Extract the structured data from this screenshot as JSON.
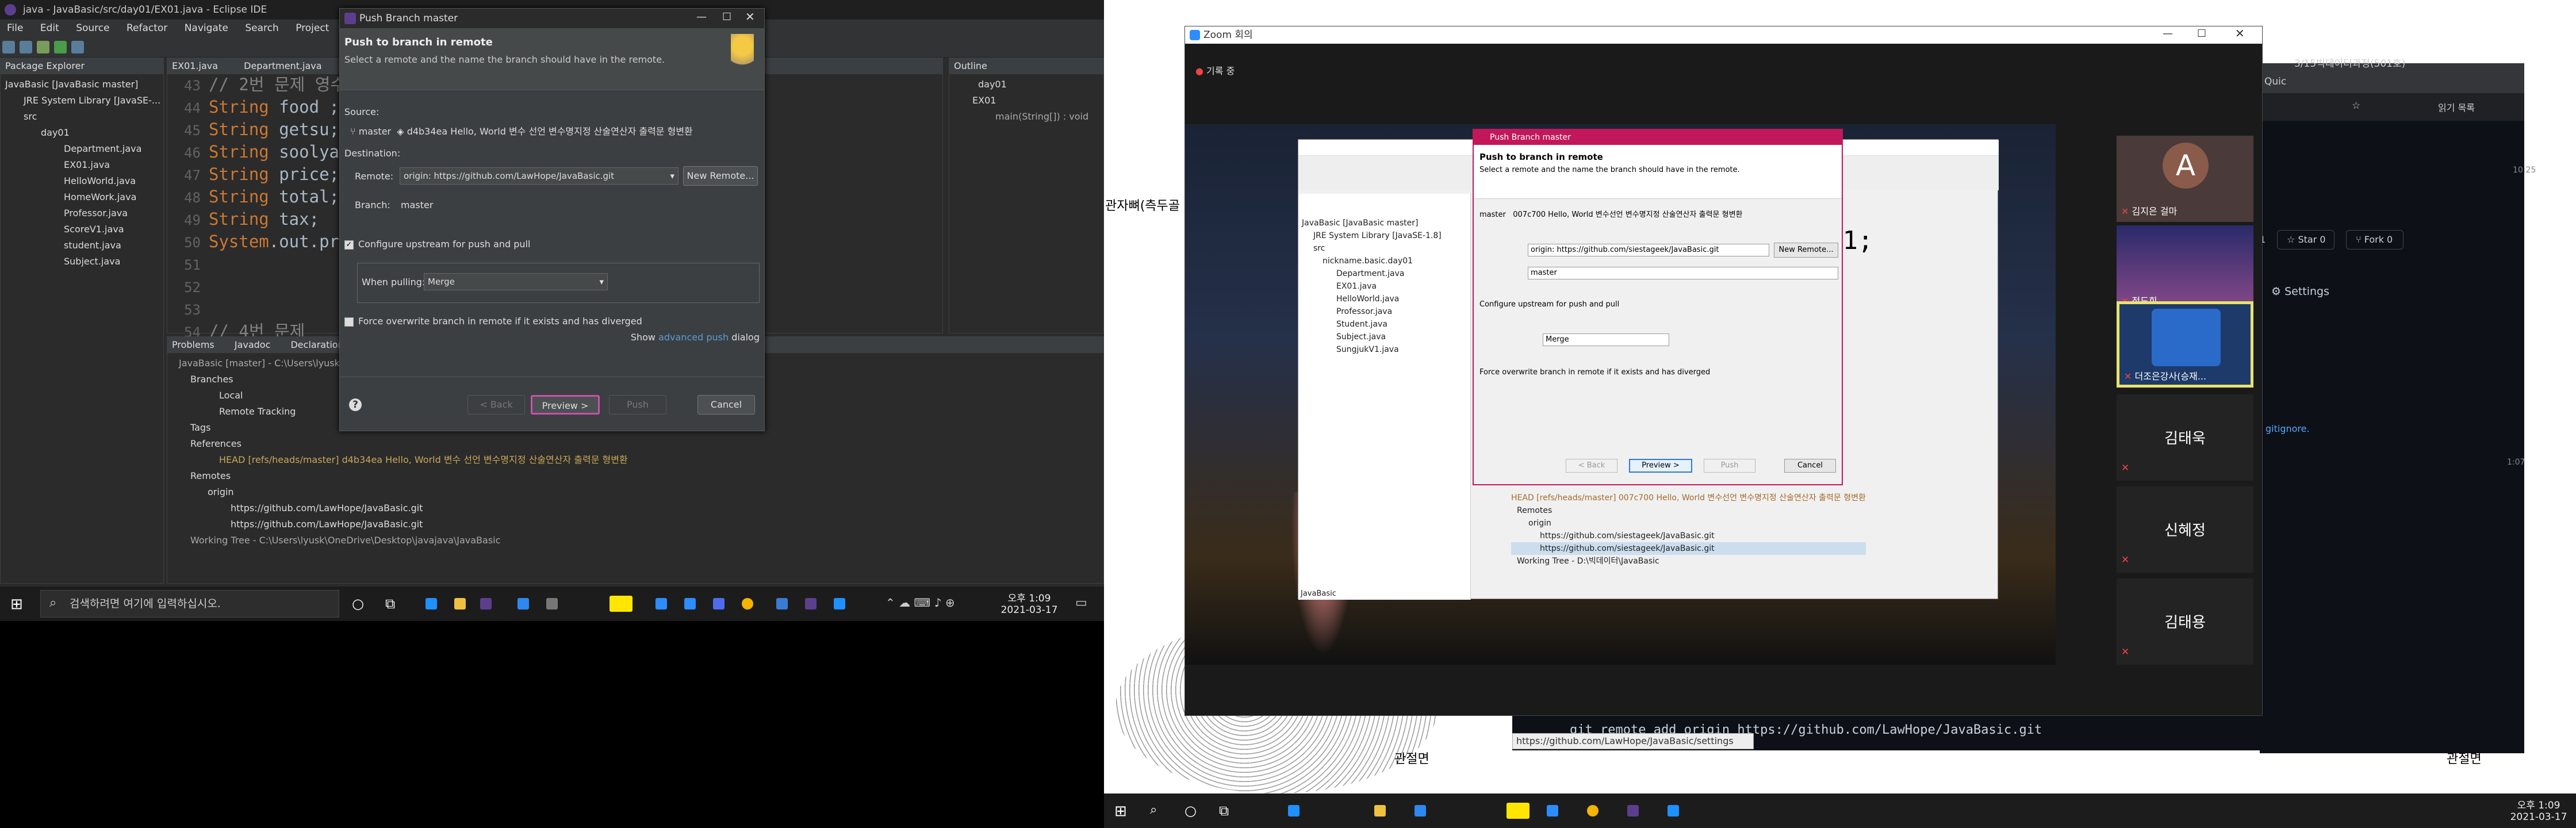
{
  "left_window": {
    "title": "java - JavaBasic/src/day01/EX01.java - Eclipse IDE",
    "menu": [
      "File",
      "Edit",
      "Source",
      "Refactor",
      "Navigate",
      "Search",
      "Project"
    ],
    "pkg_explorer_tab": "Package Explorer",
    "pkg_tree": [
      "JavaBasic [JavaBasic master]",
      "JRE System Library [JavaSE-...",
      "src",
      "day01",
      "Department.java",
      "EX01.java",
      "HelloWorld.java",
      "HomeWork.java",
      "Professor.java",
      "ScoreV1.java",
      "student.java",
      "Subject.java"
    ],
    "editor_tabs": [
      "EX01.java",
      "Department.java"
    ],
    "code_lines": [
      {
        "n": "43",
        "kw": "//",
        "txt": " 2번 문제 영수"
      },
      {
        "n": "44",
        "kw": "String",
        "txt": " food ;"
      },
      {
        "n": "45",
        "kw": "String",
        "txt": " getsu;"
      },
      {
        "n": "46",
        "kw": "String",
        "txt": " soolyang"
      },
      {
        "n": "47",
        "kw": "String",
        "txt": " price;"
      },
      {
        "n": "48",
        "kw": "String",
        "txt": " total;"
      },
      {
        "n": "49",
        "kw": "String",
        "txt": " tax;"
      },
      {
        "n": "50",
        "kw": "System",
        "txt": ".out.prin"
      },
      {
        "n": "51",
        "kw": "",
        "txt": ""
      },
      {
        "n": "52",
        "kw": "",
        "txt": ""
      },
      {
        "n": "53",
        "kw": "",
        "txt": ""
      },
      {
        "n": "54",
        "kw": "//",
        "txt": "  4번 문제"
      }
    ],
    "outline_tab": "Outline",
    "outline_items": [
      "day01",
      "EX01",
      "main(String[]) : void"
    ],
    "bottom_tabs": [
      "Problems",
      "Javadoc",
      "Declaration"
    ],
    "git_tree": [
      "JavaBasic [master] - C:\\Users\\lyusk\\OneDrive\\Desktop\\javajava\\JavaBasic\\.git",
      "Branches",
      "Local",
      "Remote Tracking",
      "Tags",
      "References",
      "HEAD [refs/heads/master] d4b34ea Hello, World 변수 선언 변수명지정 산술연산자 출력문 형변환",
      "Remotes",
      "origin",
      "https://github.com/LawHope/JavaBasic.git",
      "https://github.com/LawHope/JavaBasic.git",
      "Working Tree - C:\\Users\\lyusk\\OneDrive\\Desktop\\javajava\\JavaBasic"
    ]
  },
  "dialog": {
    "title": "Push Branch master",
    "heading": "Push to branch in remote",
    "sub": "Select a remote and the name the branch should have in the remote.",
    "source_label": "Source:",
    "source_branch": "master",
    "source_commit": "d4b34ea",
    "source_msg": "Hello, World 변수 선언 변수명지정 산술연산자 출력문 형변환",
    "destination_label": "Destination:",
    "remote_label": "Remote:",
    "remote_value": "origin: https://github.com/LawHope/JavaBasic.git",
    "new_remote": "New Remote...",
    "branch_label": "Branch:",
    "branch_value": "master",
    "configure": "Configure upstream for push and pull",
    "when_pulling": "When pulling:",
    "merge": "Merge",
    "force": "Force overwrite branch in remote if it exists and has diverged",
    "show_prefix": "Show",
    "advanced_link": "advanced push",
    "show_suffix": "dialog",
    "back": "< Back",
    "preview": "Preview >",
    "push": "Push",
    "cancel": "Cancel"
  },
  "taskbar1": {
    "search": "검색하려면 여기에 입력하십시오.",
    "time": "오후 1:09",
    "date": "2021-03-17"
  },
  "zoom": {
    "title": "Zoom 회의",
    "recording": "기록 중",
    "shared_dialog": {
      "title": "Push Branch master",
      "heading": "Push to branch in remote",
      "sub": "Select a remote and the name the branch should have in the remote.",
      "source_commit": "007c700",
      "source_msg": "Hello, World 변수선언 변수명지정 산술연산자 출력문 형변환",
      "remote_value": "origin: https://github.com/siestageek/JavaBasic.git",
      "new_remote": "New Remote...",
      "branch_value": "master",
      "configure": "Configure upstream for push and pull",
      "merge": "Merge",
      "force": "Force overwrite branch in remote if it exists and has diverged",
      "back": "< Back",
      "preview": "Preview >",
      "push": "Push",
      "cancel": "Cancel"
    },
    "shared_tree": [
      "JavaBasic [JavaBasic master]",
      "JRE System Library [JavaSE-1.8]",
      "src",
      "nickname.basic.day01",
      "Department.java",
      "EX01.java",
      "HelloWorld.java",
      "Professor.java",
      "Student.java",
      "Subject.java",
      "SungjukV1.java"
    ],
    "shared_remotes": [
      "HEAD [refs/heads/master] 007c700 Hello, World 변수선언 변수명지정 산술연산자 출력문 형변환",
      "Remotes",
      "origin",
      "https://github.com/siestageek/JavaBasic.git",
      "https://github.com/siestageek/JavaBasic.git",
      "Working Tree - D:\\빅데이터\\JavaBasic"
    ],
    "shared_code": "01;",
    "shared_status": "JavaBasic",
    "participants": [
      {
        "initial": "A",
        "name": "김지은 걸마"
      },
      {
        "initial": "",
        "name": "정도희"
      },
      {
        "initial": "",
        "name": "더조은강사(승재..."
      },
      {
        "initial": "",
        "name": "김태욱"
      },
      {
        "initial": "",
        "name": "신혜정"
      },
      {
        "initial": "",
        "name": "김태용"
      }
    ]
  },
  "background_doc": {
    "left_label": "관자뼈(측두골",
    "bottom_label": "관절면",
    "bottom_label2": "관절면"
  },
  "browser": {
    "tab1": "3/15빅데이터과정(501호)",
    "tab2": "Quic",
    "reading_list": "읽기 목록",
    "time": "10:25",
    "star": "Star",
    "star_count": "0",
    "fork": "Fork",
    "fork_count": "0",
    "watch_count": "1",
    "settings": "Settings",
    "gitignore": "gitignore.",
    "time2": "1:07",
    "git_cmd": "git remote add origin https://github.com/LawHope/JavaBasic.git",
    "status_url": "https://github.com/LawHope/JavaBasic/settings"
  },
  "taskbar2": {
    "time": "오후 1:09",
    "date": "2021-03-17"
  },
  "colors": {
    "accent": "#c94fae",
    "zoom_border": "#e8e36c",
    "eclipse_bg": "#2b2b2b"
  }
}
